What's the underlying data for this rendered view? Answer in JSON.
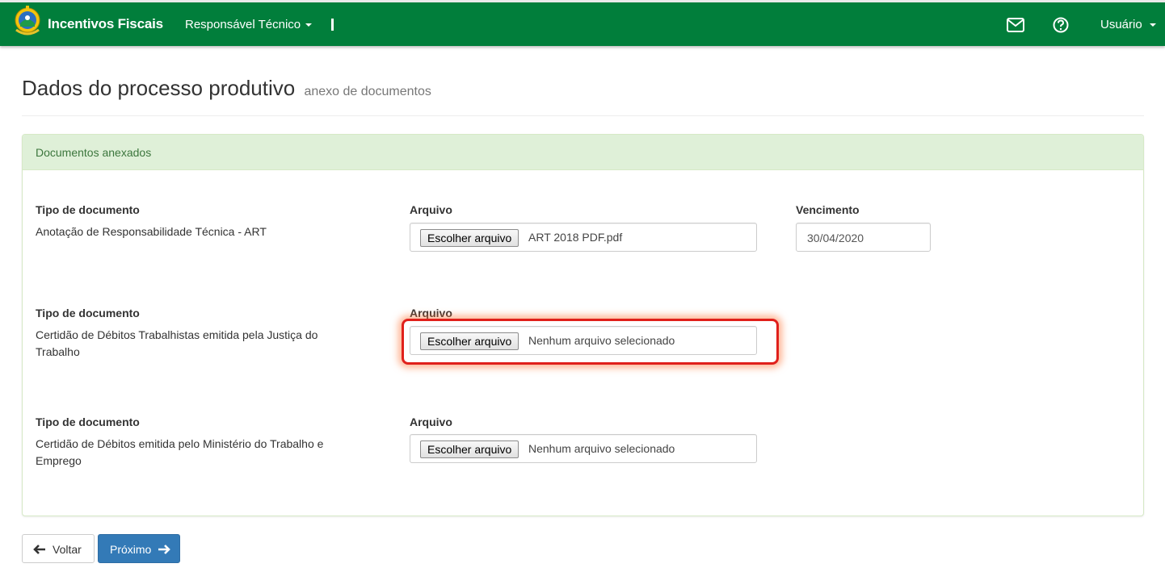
{
  "nav": {
    "brand": "Incentivos Fiscais",
    "role_menu": "Responsável Técnico",
    "user_menu": "Usuário"
  },
  "page": {
    "title": "Dados do processo produtivo",
    "subtitle": "anexo de documentos"
  },
  "panel": {
    "heading": "Documentos anexados",
    "documents": [
      {
        "type_label": "Tipo de documento",
        "type_value": "Anotação de Responsabilidade Técnica - ART",
        "file_label": "Arquivo",
        "file_button": "Escolher arquivo",
        "file_name": "ART 2018 PDF.pdf",
        "due_label": "Vencimento",
        "due_value": "30/04/2020"
      },
      {
        "type_label": "Tipo de documento",
        "type_value": "Certidão de Débitos Trabalhistas emitida pela Justiça do Trabalho",
        "file_label": "Arquivo",
        "file_button": "Escolher arquivo",
        "file_name": "Nenhum arquivo selecionado"
      },
      {
        "type_label": "Tipo de documento",
        "type_value": "Certidão de Débitos emitida pelo Ministério do Trabalho e Emprego",
        "file_label": "Arquivo",
        "file_button": "Escolher arquivo",
        "file_name": "Nenhum arquivo selecionado"
      }
    ]
  },
  "footer": {
    "back_label": "Voltar",
    "next_label": "Próximo"
  },
  "colors": {
    "navbar": "#017e3b",
    "panel_heading_bg": "#dff0d8",
    "primary_button": "#337ab7",
    "highlight": "#e0201b"
  },
  "icons": [
    "coat-of-arms-logo",
    "envelope-icon",
    "question-circle-icon",
    "arrow-left-icon",
    "arrow-right-icon",
    "caret-down-icon"
  ]
}
